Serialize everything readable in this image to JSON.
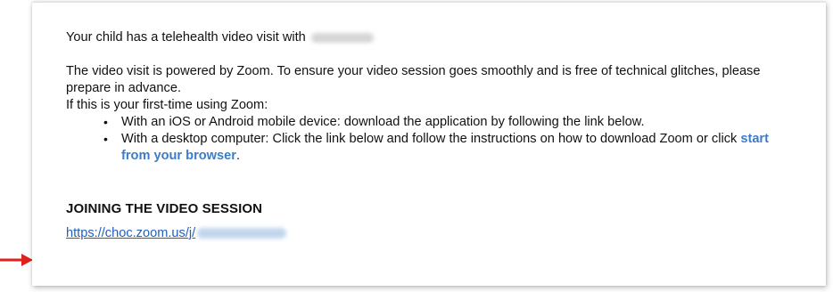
{
  "email": {
    "intro_text": "Your child has a telehealth video visit with",
    "paragraph_text": "The video visit is powered by Zoom. To ensure your video session goes smoothly and is free of technical glitches, please prepare in advance.",
    "first_time_text": "If this is your first-time using Zoom:",
    "bullets": [
      {
        "marker": "•",
        "text": "With an iOS or Android mobile device: download the application by following the link below."
      },
      {
        "marker": "•",
        "text_before": "With a desktop computer: Click the link below and follow the instructions on how to download Zoom or click",
        "link_text": "start from your browser",
        "text_after": "."
      }
    ],
    "section_heading": "JOINING THE VIDEO SESSION",
    "meeting_link_text": "https://choc.zoom.us/j/"
  },
  "colors": {
    "link_blue": "#1f5fbf",
    "bold_link_blue": "#3d7cc9",
    "arrow_red": "#e0201b"
  }
}
